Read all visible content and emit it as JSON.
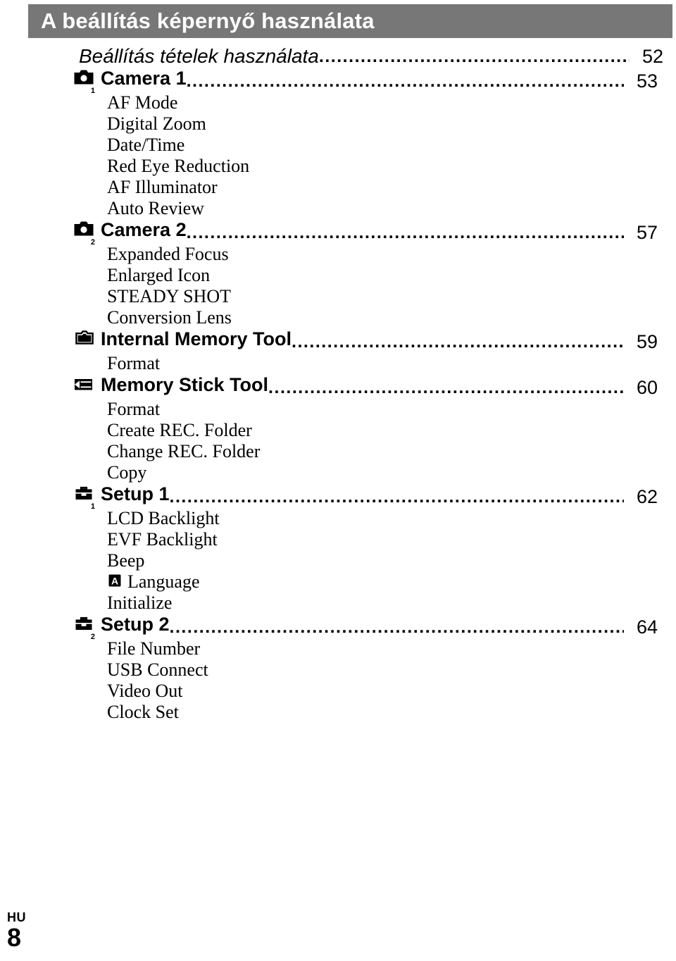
{
  "header": {
    "title": "A beállítás képernyő használata",
    "background_color": "#777777",
    "text_color": "#ffffff"
  },
  "toc": {
    "leader_dots": "........................................................................................................................................",
    "top_entry": {
      "label": "Beállítás tételek használata",
      "page": "52"
    },
    "sections": [
      {
        "icon": "camera-icon",
        "icon_subscript": "1",
        "label": "Camera 1",
        "page": "53",
        "items": [
          "AF Mode",
          "Digital Zoom",
          "Date/Time",
          "Red Eye Reduction",
          "AF Illuminator",
          "Auto Review"
        ]
      },
      {
        "icon": "camera-icon",
        "icon_subscript": "2",
        "label": "Camera 2",
        "page": "57",
        "items": [
          "Expanded Focus",
          "Enlarged Icon",
          "STEADY SHOT",
          "Conversion Lens"
        ]
      },
      {
        "icon": "internal-memory-icon",
        "icon_subscript": "",
        "label": "Internal Memory Tool",
        "page": "59",
        "items": [
          "Format"
        ]
      },
      {
        "icon": "memory-stick-icon",
        "icon_subscript": "",
        "label": "Memory Stick Tool",
        "page": "60",
        "items": [
          "Format",
          "Create REC. Folder",
          "Change REC. Folder",
          "Copy"
        ]
      },
      {
        "icon": "toolbox-icon",
        "icon_subscript": "1",
        "label": "Setup 1",
        "page": "62",
        "items": [
          "LCD Backlight",
          "EVF Backlight",
          "Beep",
          "Language",
          "Initialize"
        ],
        "item_icons": {
          "3": "language-a-icon"
        }
      },
      {
        "icon": "toolbox-icon",
        "icon_subscript": "2",
        "label": "Setup 2",
        "page": "64",
        "items": [
          "File Number",
          "USB Connect",
          "Video Out",
          "Clock Set"
        ]
      }
    ]
  },
  "footer": {
    "locale": "HU",
    "page_number": "8"
  }
}
